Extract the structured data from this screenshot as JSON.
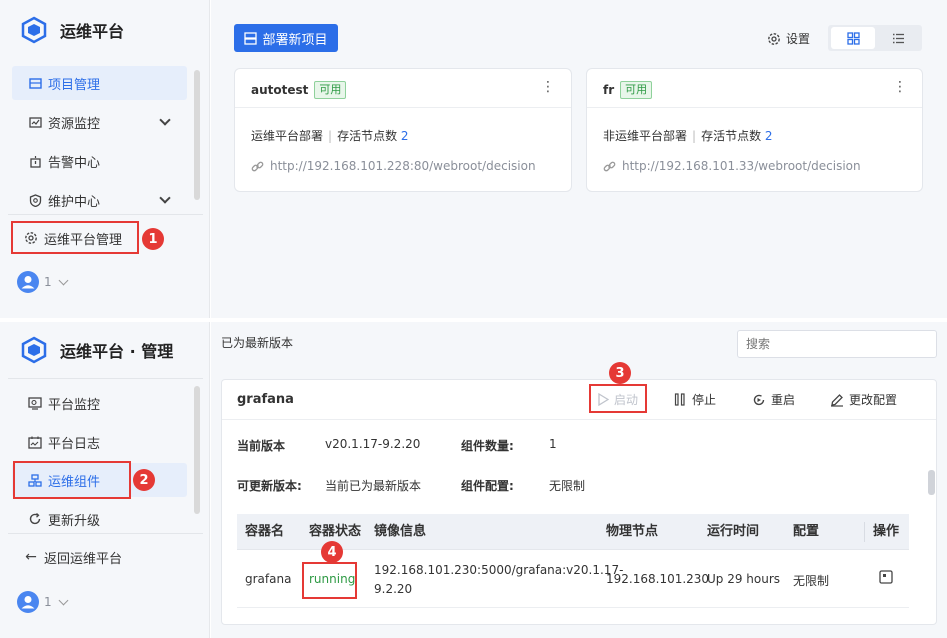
{
  "top": {
    "brand": "运维平台",
    "nav": [
      {
        "label": "项目管理"
      },
      {
        "label": "资源监控"
      },
      {
        "label": "告警中心"
      },
      {
        "label": "维护中心"
      }
    ],
    "admin_label": "运维平台管理",
    "user_count": "1",
    "deploy_button": "部署新项目",
    "settings_label": "设置",
    "projects": [
      {
        "name": "autotest",
        "status": "可用",
        "type": "运维平台部署",
        "nodes_label": "存活节点数",
        "nodes": "2",
        "url": "http://192.168.101.228:80/webroot/decision"
      },
      {
        "name": "fr",
        "status": "可用",
        "type": "非运维平台部署",
        "nodes_label": "存活节点数",
        "nodes": "2",
        "url": "http://192.168.101.33/webroot/decision"
      }
    ]
  },
  "bottom": {
    "brand": "运维平台 · 管理",
    "nav": [
      {
        "label": "平台监控"
      },
      {
        "label": "平台日志"
      },
      {
        "label": "运维组件"
      },
      {
        "label": "更新升级"
      }
    ],
    "back_label": "返回运维平台",
    "user_count": "1",
    "version_status": "已为最新版本",
    "search_placeholder": "搜索",
    "component": {
      "name": "grafana",
      "actions": {
        "start": "启动",
        "stop": "停止",
        "restart": "重启",
        "config": "更改配置"
      },
      "current_version_label": "当前版本",
      "current_version": "v20.1.17-9.2.20",
      "count_label": "组件数量:",
      "count": "1",
      "updatable_label": "可更新版本:",
      "updatable": "当前已为最新版本",
      "config_label": "组件配置:",
      "config": "无限制",
      "table": {
        "headers": [
          "容器名",
          "容器状态",
          "镜像信息",
          "物理节点",
          "运行时间",
          "配置",
          "操作"
        ],
        "row": {
          "name": "grafana",
          "status": "running",
          "image_line1": "192.168.101.230:5000/grafana:v20.1.17-",
          "image_line2": "9.2.20",
          "node": "192.168.101.230",
          "uptime": "Up 29 hours",
          "config": "无限制"
        }
      }
    }
  },
  "annotations": [
    "1",
    "2",
    "3",
    "4"
  ]
}
